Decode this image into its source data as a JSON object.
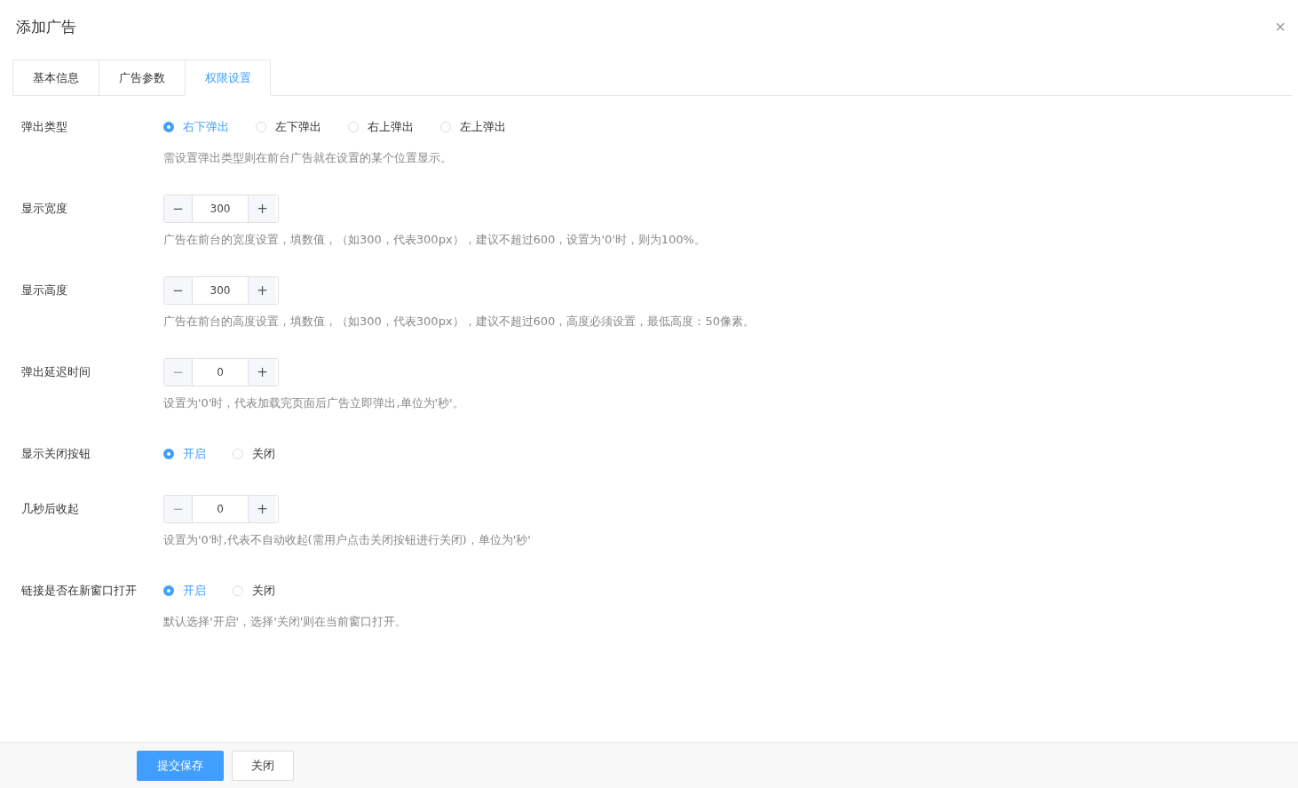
{
  "dialog": {
    "title": "添加广告",
    "close": "×"
  },
  "tabs": [
    {
      "label": "基本信息",
      "selected": false
    },
    {
      "label": "广告参数",
      "selected": false
    },
    {
      "label": "权限设置",
      "selected": true
    }
  ],
  "fields": [
    {
      "kind": "radio",
      "label": "弹出类型",
      "options": [
        {
          "label": "右下弹出",
          "selected": true
        },
        {
          "label": "左下弹出",
          "selected": false
        },
        {
          "label": "右上弹出",
          "selected": false
        },
        {
          "label": "左上弹出",
          "selected": false
        }
      ],
      "hint": "需设置弹出类型则在前台广告就在设置的某个位置显示。"
    },
    {
      "kind": "stepper",
      "label": "显示宽度",
      "minus": "−",
      "value": "300",
      "plus": "+",
      "minus_disabled": false,
      "hint": "广告在前台的宽度设置，填数值，（如300，代表300px），建议不超过600，设置为'0'时，则为100%。"
    },
    {
      "kind": "stepper",
      "label": "显示高度",
      "minus": "−",
      "value": "300",
      "plus": "+",
      "minus_disabled": false,
      "hint": "广告在前台的高度设置，填数值，（如300，代表300px），建议不超过600，高度必须设置，最低高度：50像素。"
    },
    {
      "kind": "stepper",
      "label": "弹出延迟时间",
      "minus": "−",
      "value": "0",
      "plus": "+",
      "minus_disabled": true,
      "hint": "设置为'0'时，代表加载完页面后广告立即弹出,单位为'秒'。"
    },
    {
      "kind": "radio",
      "label": "显示关闭按钮",
      "options": [
        {
          "label": "开启",
          "selected": true
        },
        {
          "label": "关闭",
          "selected": false
        }
      ]
    },
    {
      "kind": "stepper",
      "label": "几秒后收起",
      "minus": "−",
      "value": "0",
      "plus": "+",
      "minus_disabled": true,
      "hint": "设置为'0'时,代表不自动收起(需用户点击关闭按钮进行关闭)，单位为'秒'"
    },
    {
      "kind": "radio",
      "label": "链接是否在新窗口打开",
      "options": [
        {
          "label": "开启",
          "selected": true
        },
        {
          "label": "关闭",
          "selected": false
        }
      ],
      "hint": "默认选择'开启'，选择'关闭'则在当前窗口打开。"
    }
  ],
  "footer": {
    "buttons": [
      {
        "label": "提交保存",
        "kind": "primary"
      },
      {
        "label": "关闭",
        "kind": "default"
      }
    ]
  }
}
